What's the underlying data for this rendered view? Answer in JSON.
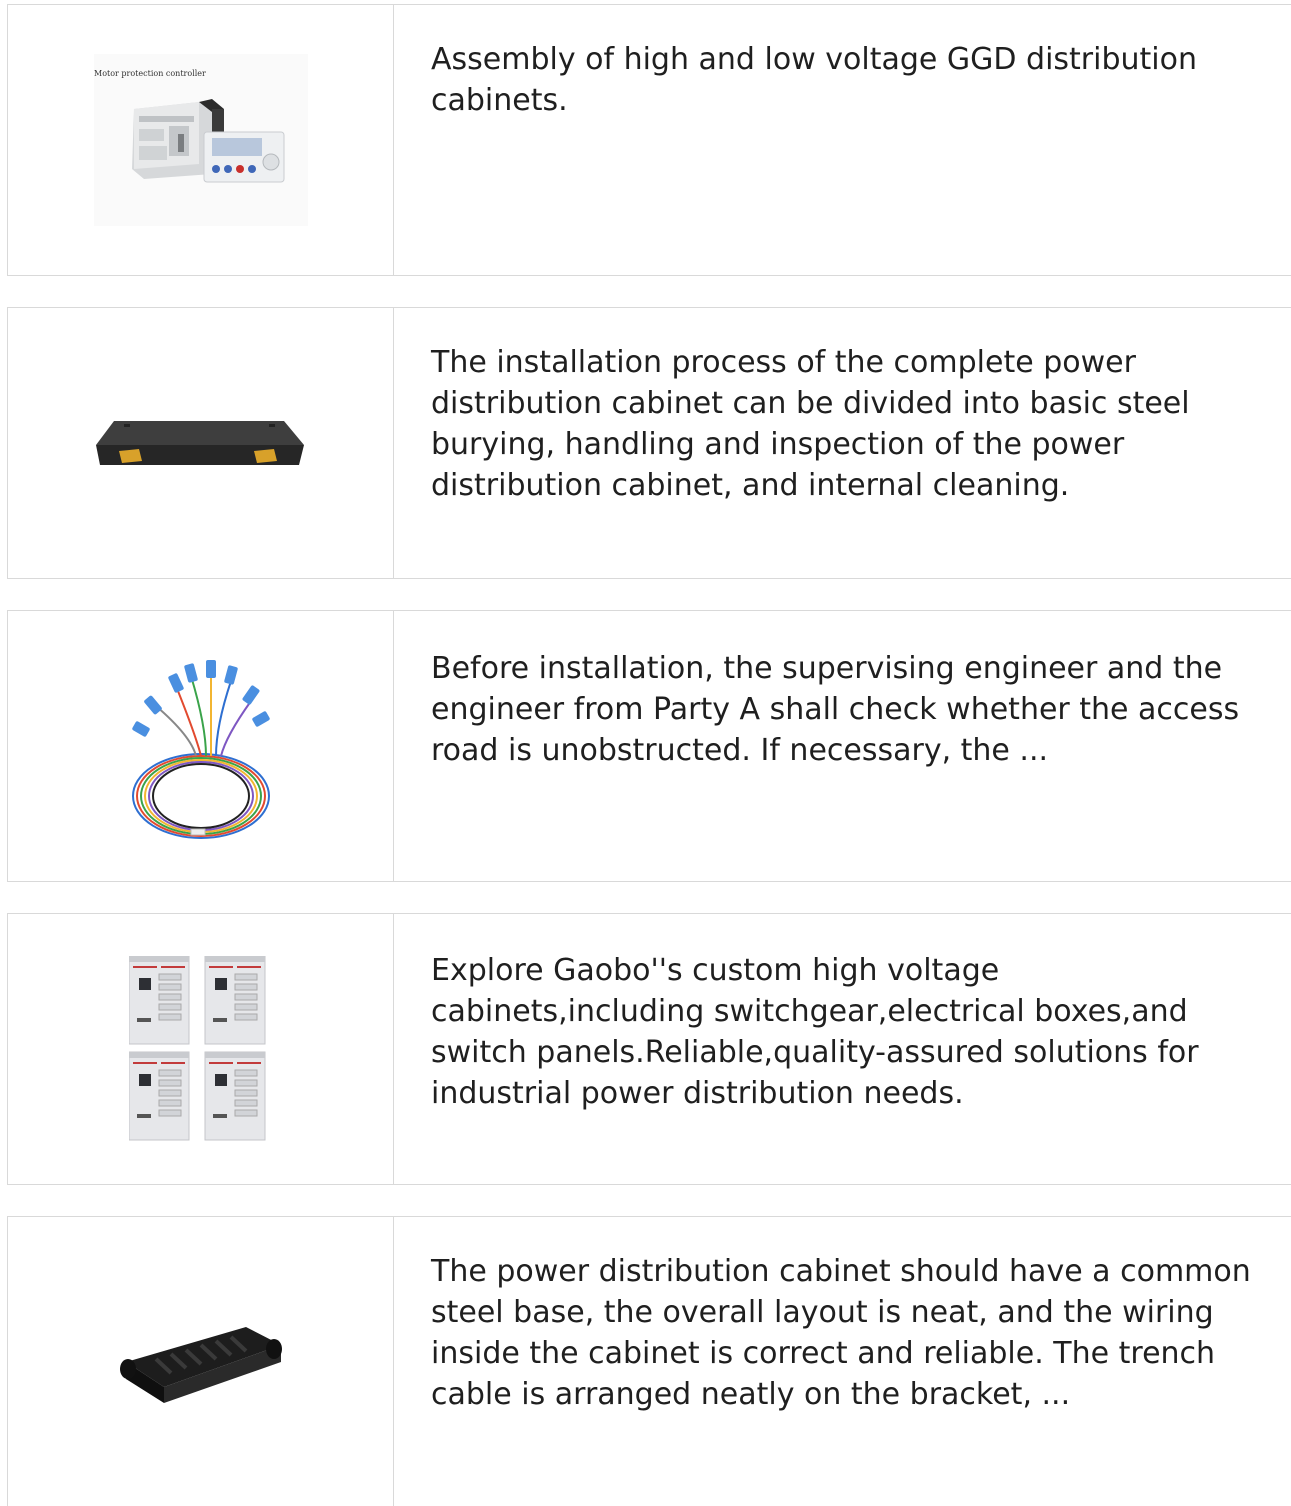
{
  "items": [
    {
      "image_name": "motor-protection-controller",
      "image_caption": "Motor protection controller",
      "text": "Assembly of high and low voltage GGD distribution cabinets."
    },
    {
      "image_name": "rack-mount-fiber-box",
      "text": "The installation process of the complete power distribution cabinet can be divided into basic steel burying, handling and inspection of the power distribution cabinet, and internal cleaning."
    },
    {
      "image_name": "fiber-pigtail-bundle",
      "text": "Before installation, the supervising engineer and the engineer from Party A shall check whether the access road is unobstructed. If necessary, the ..."
    },
    {
      "image_name": "high-voltage-cabinets",
      "text": "Explore Gaobo''s custom high voltage cabinets,including switchgear,electrical boxes,and switch panels.Reliable,quality-assured solutions for industrial power distribution needs."
    },
    {
      "image_name": "fiber-splice-closure",
      "text": "The power distribution cabinet should have a common steel base, the overall layout is neat, and the wiring inside the cabinet is correct and reliable. The trench cable is arranged neatly on the bracket, ..."
    }
  ]
}
